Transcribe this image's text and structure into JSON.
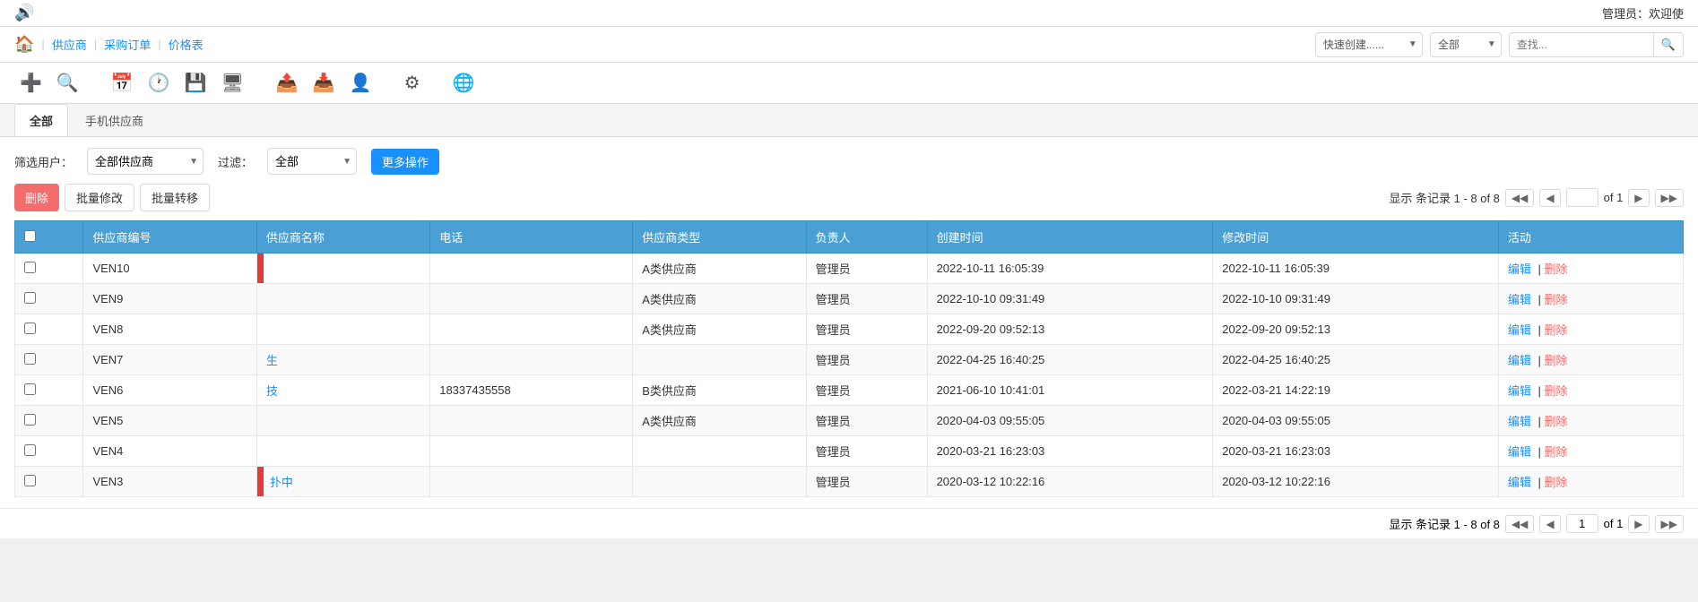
{
  "topbar": {
    "admin_text": "管理员：欢迎使"
  },
  "navbar": {
    "home_icon": "🏠",
    "links": [
      "供应商",
      "采购订单",
      "价格表"
    ],
    "quick_create_placeholder": "快速创建......",
    "filter_all": "全部",
    "search_placeholder": "查找..."
  },
  "toolbar": {
    "icons": [
      {
        "name": "add-icon",
        "symbol": "➕"
      },
      {
        "name": "search-icon",
        "symbol": "🔍"
      },
      {
        "name": "calendar-icon",
        "symbol": "📅"
      },
      {
        "name": "clock-icon",
        "symbol": "🕐"
      },
      {
        "name": "save-icon",
        "symbol": "💾"
      },
      {
        "name": "monitor-icon",
        "symbol": "🖥"
      },
      {
        "name": "export-icon",
        "symbol": "📤"
      },
      {
        "name": "import-icon",
        "symbol": "📥"
      },
      {
        "name": "user-icon",
        "symbol": "👤"
      },
      {
        "name": "settings-icon",
        "symbol": "⚙"
      },
      {
        "name": "network-icon",
        "symbol": "🌐"
      }
    ]
  },
  "tabs": [
    {
      "label": "全部",
      "active": true
    },
    {
      "label": "手机供应商",
      "active": false
    }
  ],
  "filter": {
    "label": "筛选用户：",
    "user_options": [
      "全部供应商"
    ],
    "user_selected": "全部供应商",
    "filter_label": "过滤：",
    "filter_options": [
      "全部"
    ],
    "filter_selected": "全部",
    "more_ops_label": "更多操作"
  },
  "actions": {
    "delete_label": "删除",
    "batch_modify_label": "批量修改",
    "batch_transfer_label": "批量转移"
  },
  "pagination": {
    "top_info": "显示 条记录 1 - 8 of 8",
    "current_page": "1",
    "total_pages": "of 1",
    "bottom_info": "显示 条记录 1 - 8 of 8"
  },
  "table": {
    "headers": [
      "",
      "供应商编号",
      "供应商名称",
      "电话",
      "供应商类型",
      "负责人",
      "创建时间",
      "修改时间",
      "活动"
    ],
    "rows": [
      {
        "id": "VEN10",
        "name": "",
        "name_text": "",
        "phone": "",
        "type": "A类供应商",
        "owner": "管理员",
        "created": "2022-10-11 16:05:39",
        "modified": "2022-10-11 16:05:39",
        "has_red_bar": true,
        "name_link": ""
      },
      {
        "id": "VEN9",
        "name": "",
        "name_text": "",
        "phone": "",
        "type": "A类供应商",
        "owner": "管理员",
        "created": "2022-10-10 09:31:49",
        "modified": "2022-10-10 09:31:49",
        "has_red_bar": false,
        "name_link": ""
      },
      {
        "id": "VEN8",
        "name": "",
        "name_text": "",
        "phone": "",
        "type": "A类供应商",
        "owner": "管理员",
        "created": "2022-09-20 09:52:13",
        "modified": "2022-09-20 09:52:13",
        "has_red_bar": false,
        "name_link": ""
      },
      {
        "id": "VEN7",
        "name": "生",
        "name_text": "生",
        "phone": "",
        "type": "",
        "owner": "管理员",
        "created": "2022-04-25 16:40:25",
        "modified": "2022-04-25 16:40:25",
        "has_red_bar": false,
        "name_link": "生"
      },
      {
        "id": "VEN6",
        "name": "技",
        "name_text": "技",
        "phone": "18337435558",
        "type": "B类供应商",
        "owner": "管理员",
        "created": "2021-06-10 10:41:01",
        "modified": "2022-03-21 14:22:19",
        "has_red_bar": false,
        "name_link": "技"
      },
      {
        "id": "VEN5",
        "name": "",
        "name_text": "",
        "phone": "",
        "type": "A类供应商",
        "owner": "管理员",
        "created": "2020-04-03 09:55:05",
        "modified": "2020-04-03 09:55:05",
        "has_red_bar": false,
        "name_link": ""
      },
      {
        "id": "VEN4",
        "name": "",
        "name_text": "",
        "phone": "",
        "type": "",
        "owner": "管理员",
        "created": "2020-03-21 16:23:03",
        "modified": "2020-03-21 16:23:03",
        "has_red_bar": false,
        "name_link": ""
      },
      {
        "id": "VEN3",
        "name": "扑中",
        "name_text": "扑中",
        "phone": "",
        "type": "",
        "owner": "管理员",
        "created": "2020-03-12 10:22:16",
        "modified": "2020-03-12 10:22:16",
        "has_red_bar": true,
        "name_link": "扑中"
      }
    ],
    "action_edit": "编辑",
    "action_delete": "删除"
  }
}
